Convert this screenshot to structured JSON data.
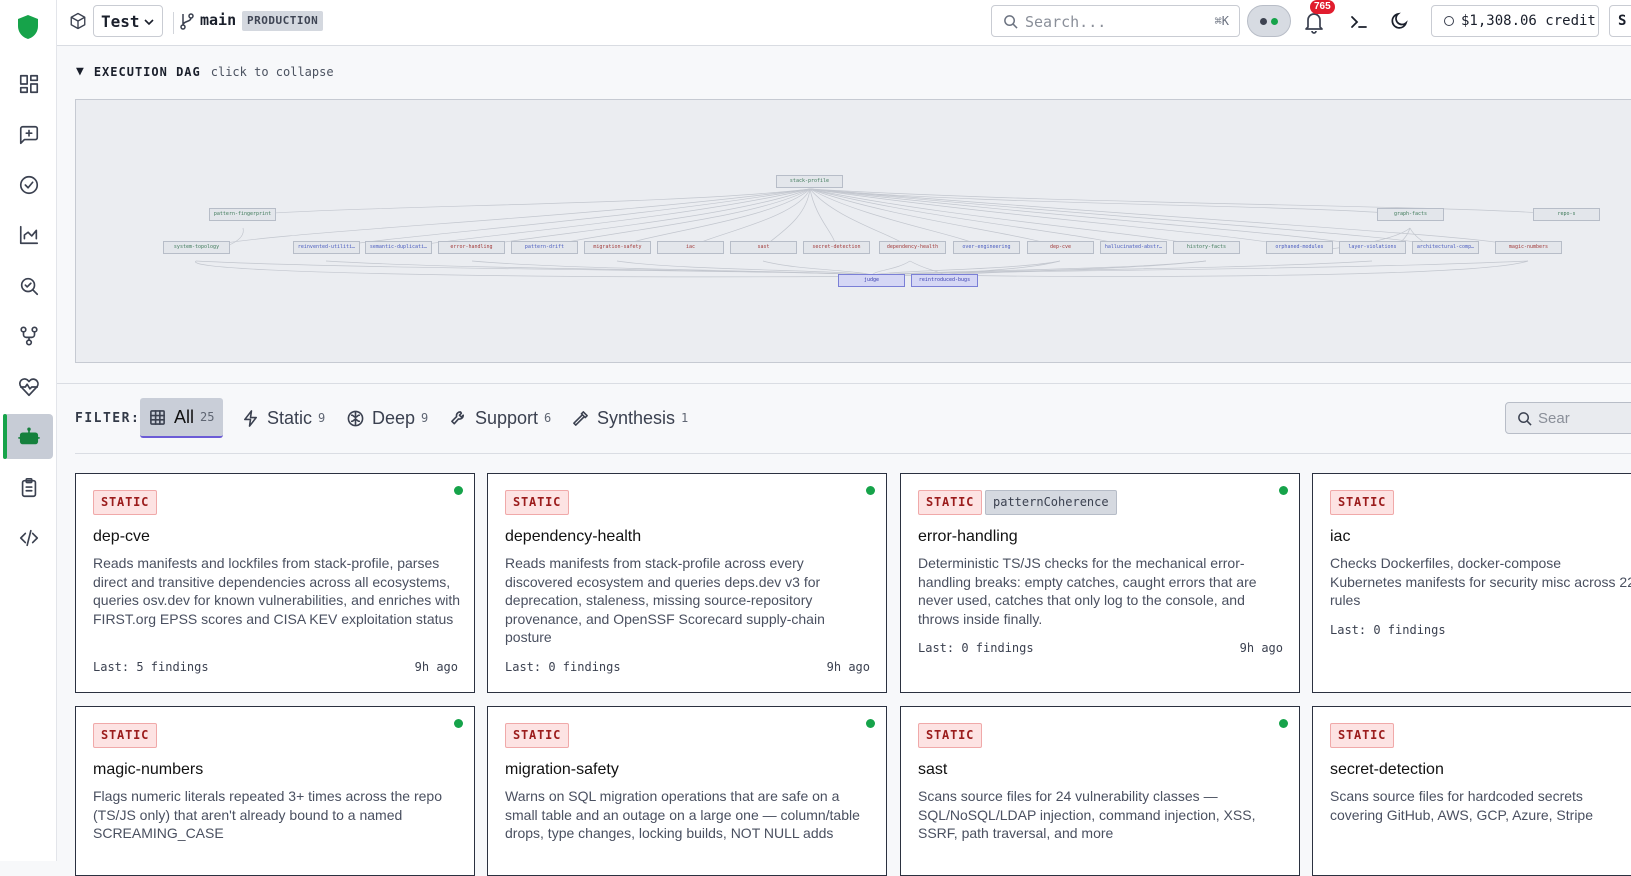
{
  "topbar": {
    "project": "Test",
    "branch": "main",
    "environment": "PRODUCTION",
    "search_placeholder": "Search...",
    "search_shortcut": "⌘K",
    "notification_count": "765",
    "credit": "$1,308.06 credit",
    "user_initial": "S"
  },
  "sidebar": {
    "items": [
      {
        "icon": "dashboard-icon"
      },
      {
        "icon": "new-chat-icon"
      },
      {
        "icon": "check-circle-icon"
      },
      {
        "icon": "chart-icon"
      },
      {
        "icon": "scan-search-icon"
      },
      {
        "icon": "workflow-icon"
      },
      {
        "icon": "heart-pulse-icon"
      },
      {
        "icon": "bot-icon",
        "active": true
      },
      {
        "icon": "clipboard-icon"
      },
      {
        "icon": "code-icon"
      }
    ]
  },
  "dag": {
    "title": "EXECUTION DAG",
    "hint": "click to collapse",
    "nodes": {
      "root": "stack-profile",
      "pattern_fingerprint": "pattern-fingerprint",
      "graph_facts": "graph-facts",
      "repo_cut": "repo-s",
      "system_topology": "system-topology",
      "reinvented": "reinvented-utiliti…",
      "semantic_dup": "semantic-duplicati…",
      "error_handling": "error-handling",
      "pattern_drift": "pattern-drift",
      "migration_safety": "migration-safety",
      "iac": "iac",
      "sast": "sast",
      "secret_detection": "secret-detection",
      "dependency_health": "dependency-health",
      "over_engineering": "over-engineering",
      "dep_cve": "dep-cve",
      "hallucinated": "hallucinated-abstr…",
      "history_facts": "history-facts",
      "orphaned_modules": "orphaned-modules",
      "layer_violations": "layer-violations",
      "architectural": "architectural-comp…",
      "magic_numbers": "magic-numbers",
      "judge": "judge",
      "reintroduced": "reintroduced-bugs"
    }
  },
  "filter": {
    "label": "FILTER:",
    "tabs": [
      {
        "label": "All",
        "count": "25",
        "icon": "grid-icon",
        "active": true
      },
      {
        "label": "Static",
        "count": "9",
        "icon": "lightning-icon"
      },
      {
        "label": "Deep",
        "count": "9",
        "icon": "brain-icon"
      },
      {
        "label": "Support",
        "count": "6",
        "icon": "wrench-icon"
      },
      {
        "label": "Synthesis",
        "count": "1",
        "icon": "hammer-icon"
      }
    ],
    "search_placeholder": "Sear"
  },
  "cards": [
    {
      "badge": "STATIC",
      "name": "dep-cve",
      "desc": "Reads manifests and lockfiles from stack-profile, parses direct and transitive dependencies across all ecosystems, queries osv.dev for known vulnerabilities, and enriches with FIRST.org EPSS scores and CISA KEV exploitation status",
      "last": "Last: 5 findings",
      "ago": "9h ago"
    },
    {
      "badge": "STATIC",
      "name": "dependency-health",
      "desc": "Reads manifests from stack-profile across every discovered ecosystem and queries deps.dev v3 for deprecation, staleness, missing source-repository provenance, and OpenSSF Scorecard supply-chain posture",
      "last": "Last: 0 findings",
      "ago": "9h ago"
    },
    {
      "badge": "STATIC",
      "badge2": "patternCoherence",
      "name": "error-handling",
      "desc": "Deterministic TS/JS checks for the mechanical error-handling breaks: empty catches, caught errors that are never used, catches that only log to the console, and throws inside finally.",
      "last": "Last: 0 findings",
      "ago": "9h ago"
    },
    {
      "badge": "STATIC",
      "name": "iac",
      "desc": "Checks Dockerfiles, docker-compose Kubernetes manifests for security misc across 22 rules",
      "last": "Last: 0 findings",
      "ago": ""
    },
    {
      "badge": "STATIC",
      "name": "magic-numbers",
      "desc": "Flags numeric literals repeated 3+ times across the repo (TS/JS only) that aren't already bound to a named SCREAMING_CASE",
      "last": "",
      "ago": ""
    },
    {
      "badge": "STATIC",
      "name": "migration-safety",
      "desc": "Warns on SQL migration operations that are safe on a small table and an outage on a large one — column/table drops, type changes, locking builds, NOT NULL adds",
      "last": "",
      "ago": ""
    },
    {
      "badge": "STATIC",
      "name": "sast",
      "desc": "Scans source files for 24 vulnerability classes — SQL/NoSQL/LDAP injection, command injection, XSS, SSRF, path traversal, and more",
      "last": "",
      "ago": ""
    },
    {
      "badge": "STATIC",
      "name": "secret-detection",
      "desc": "Scans source files for hardcoded secrets covering GitHub, AWS, GCP, Azure, Stripe",
      "last": "",
      "ago": ""
    }
  ]
}
